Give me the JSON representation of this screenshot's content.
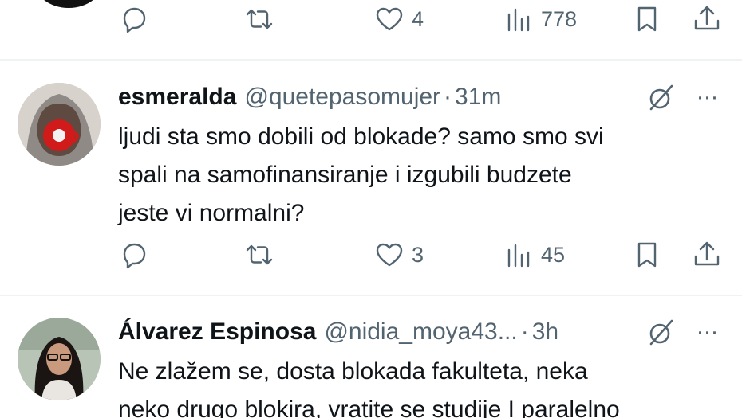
{
  "tweets": [
    {
      "actions": {
        "replies": "",
        "reposts": "",
        "likes": "4",
        "views": "778"
      }
    },
    {
      "name": "esmeralda",
      "handle": "@quetepasomujer",
      "separator": "·",
      "time": "31m",
      "more": "···",
      "text_lines": [
        "ljudi sta smo dobili od blokade? samo smo svi",
        "spali na samofinansiranje i izgubili budzete",
        "jeste vi normalni?"
      ],
      "actions": {
        "replies": "",
        "reposts": "",
        "likes": "3",
        "views": "45"
      }
    },
    {
      "name": "Álvarez Espinosa",
      "handle": "@nidia_moya43...",
      "separator": "·",
      "time": "3h",
      "more": "···",
      "text_lines": [
        "Ne zlažem se, dosta blokada fakulteta, neka",
        "neko drugo blokira, vratite se studije I paralelno"
      ]
    }
  ],
  "icons": {
    "reply": "reply-icon",
    "repost": "repost-icon",
    "like": "heart-icon",
    "views": "views-icon",
    "bookmark": "bookmark-icon",
    "share": "share-icon",
    "grok": "grok-icon",
    "more": "more-icon"
  },
  "colors": {
    "text": "#0f1419",
    "muted": "#536471",
    "divider": "#eff3f4"
  }
}
